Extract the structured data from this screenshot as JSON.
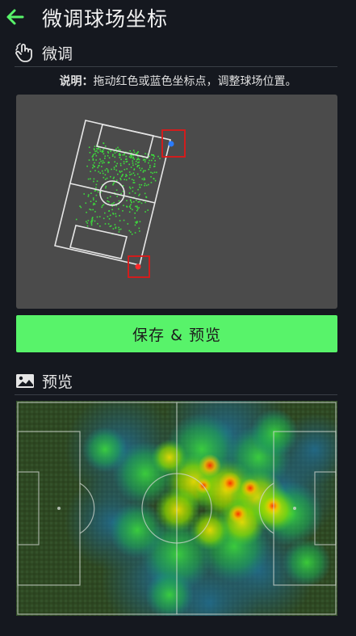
{
  "header": {
    "title": "微调球场坐标",
    "back_icon": "arrow-left-icon"
  },
  "tune_section": {
    "label": "微调",
    "icon": "hand-pointer-icon"
  },
  "instruction": {
    "prefix": "说明：",
    "text": "拖动红色或蓝色坐标点，调整球场位置。"
  },
  "save_button": {
    "label": "保存 & 预览"
  },
  "preview_section": {
    "label": "预览",
    "icon": "image-icon"
  },
  "colors": {
    "accent": "#58f36a",
    "handle_red": "#ff2a2a",
    "handle_blue": "#2a7bff",
    "handle_box": "#e01818",
    "scatter": "#3ddc3d",
    "pitch_grass": "#2f4a22"
  }
}
